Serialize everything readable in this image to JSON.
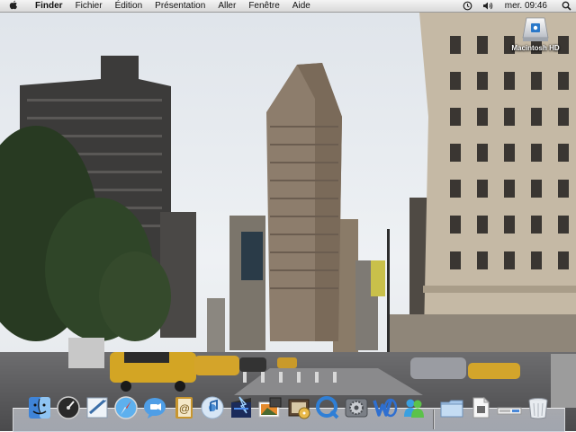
{
  "menubar": {
    "app_name": "Finder",
    "items": [
      "Fichier",
      "Édition",
      "Présentation",
      "Aller",
      "Fenêtre",
      "Aide"
    ],
    "clock": "mer. 09:46"
  },
  "desktop": {
    "icons": [
      {
        "label": "Macintosh HD",
        "icon": "hard-drive-icon"
      }
    ]
  },
  "dock": {
    "items": [
      {
        "name": "finder",
        "icon": "finder-icon"
      },
      {
        "name": "dashboard",
        "icon": "dashboard-icon"
      },
      {
        "name": "mail",
        "icon": "mail-icon"
      },
      {
        "name": "safari",
        "icon": "safari-icon"
      },
      {
        "name": "ichat",
        "icon": "ichat-icon"
      },
      {
        "name": "address-book",
        "icon": "address-book-icon"
      },
      {
        "name": "itunes",
        "icon": "itunes-icon"
      },
      {
        "name": "imovie",
        "icon": "imovie-icon"
      },
      {
        "name": "iphoto",
        "icon": "iphoto-icon"
      },
      {
        "name": "idvd",
        "icon": "idvd-icon"
      },
      {
        "name": "quicktime",
        "icon": "quicktime-icon"
      },
      {
        "name": "system-preferences",
        "icon": "system-preferences-icon"
      },
      {
        "name": "word",
        "icon": "word-icon"
      },
      {
        "name": "messenger",
        "icon": "messenger-icon"
      },
      {
        "name": "applications-folder",
        "icon": "folder-icon"
      },
      {
        "name": "document",
        "icon": "document-icon"
      },
      {
        "name": "keyboard-stack",
        "icon": "stack-icon"
      },
      {
        "name": "trash",
        "icon": "trash-icon"
      }
    ]
  }
}
